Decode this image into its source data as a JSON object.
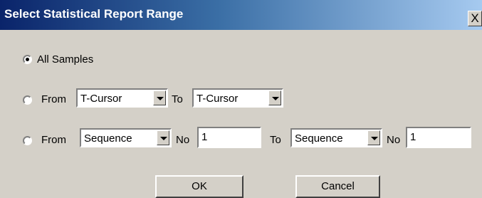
{
  "dialog": {
    "title": "Select Statistical Report Range",
    "close_label": "X"
  },
  "options": {
    "all_samples": {
      "label": "All Samples",
      "selected": true
    },
    "from_cursor": {
      "from_label": "From",
      "from_value": "T-Cursor",
      "to_label": "To",
      "to_value": "T-Cursor",
      "selected": false
    },
    "from_sequence": {
      "from_label": "From",
      "from_value": "Sequence",
      "no_label": "No",
      "from_no": "1",
      "to_label": "To",
      "to_value": "Sequence",
      "to_no_label": "No",
      "to_no": "1",
      "selected": false
    }
  },
  "buttons": {
    "ok": "OK",
    "cancel": "Cancel"
  }
}
